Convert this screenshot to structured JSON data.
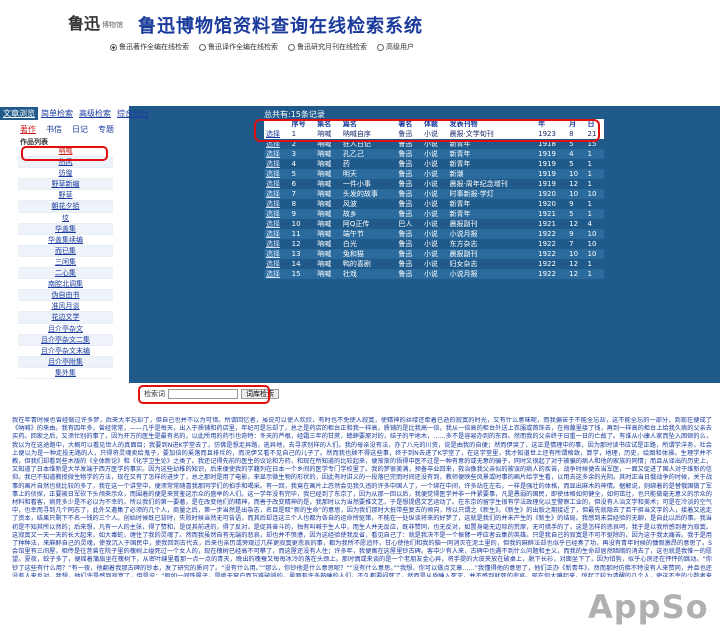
{
  "header": {
    "logo_main": "鲁迅",
    "logo_sub": "博物馆",
    "title": "鲁迅博物馆资料查询在线检索系统",
    "radios": [
      {
        "label": "鲁迅著作全编在线检索",
        "checked": true
      },
      {
        "label": "鲁迅译作全编在线检索",
        "checked": false
      },
      {
        "label": "鲁迅研究月刊在线检索",
        "checked": false
      },
      {
        "label": "高级用户",
        "checked": false
      }
    ]
  },
  "nav": {
    "tabs": [
      "文章浏览",
      "简单检索",
      "高级检索",
      "综合统计"
    ],
    "subtabs": [
      "著作",
      "书信",
      "日记",
      "专题"
    ],
    "work_header": "作品列表",
    "works": [
      "呐喊",
      "热风",
      "彷徨",
      "野草新编",
      "野草",
      "朝花夕拾",
      "坟",
      "华盖集",
      "华盖集续编",
      "而已集",
      "三闲集",
      "二心集",
      "南腔北调集",
      "伪自由书",
      "准风月谈",
      "花边文学",
      "且介亭杂文",
      "且介亭杂文二集",
      "且介亭杂文末编",
      "且介亭附集",
      "集外集"
    ]
  },
  "results": {
    "total": "总共有:15条记录",
    "columns": [
      "",
      "序号",
      "集名",
      "篇名",
      "署名",
      "体裁",
      "发表刊物",
      "年",
      "月",
      "日"
    ],
    "rows": [
      [
        "选择",
        "1",
        "呐喊",
        "呐喊自序",
        "鲁迅",
        "小说",
        "晨报·文学旬刊",
        "1923",
        "8",
        "21"
      ],
      [
        "选择",
        "2",
        "呐喊",
        "狂人日记",
        "鲁迅",
        "小说",
        "新青年",
        "1918",
        "5",
        "15"
      ],
      [
        "选择",
        "3",
        "呐喊",
        "孔乙己",
        "鲁迅",
        "小说",
        "新青年",
        "1919",
        "4",
        "1"
      ],
      [
        "选择",
        "4",
        "呐喊",
        "药",
        "鲁迅",
        "小说",
        "新青年",
        "1919",
        "5",
        "1"
      ],
      [
        "选择",
        "5",
        "呐喊",
        "明天",
        "鲁迅",
        "小说",
        "新潮",
        "1919",
        "10",
        "1"
      ],
      [
        "选择",
        "6",
        "呐喊",
        "一件小事",
        "鲁迅",
        "小说",
        "晨报·周年纪念增刊",
        "1919",
        "12",
        "1"
      ],
      [
        "选择",
        "7",
        "呐喊",
        "头发的故事",
        "鲁迅",
        "小说",
        "时事新报·学灯",
        "1920",
        "10",
        "10"
      ],
      [
        "选择",
        "8",
        "呐喊",
        "风波",
        "鲁迅",
        "小说",
        "新青年",
        "1920",
        "9",
        "1"
      ],
      [
        "选择",
        "9",
        "呐喊",
        "故乡",
        "鲁迅",
        "小说",
        "新青年",
        "1921",
        "5",
        "1"
      ],
      [
        "选择",
        "10",
        "呐喊",
        "阿Q正传",
        "巴人",
        "小说",
        "晨报副刊",
        "1921",
        "12",
        "4"
      ],
      [
        "选择",
        "11",
        "呐喊",
        "端午节",
        "鲁迅",
        "小说",
        "小说月报",
        "1922",
        "9",
        "10"
      ],
      [
        "选择",
        "12",
        "呐喊",
        "白光",
        "鲁迅",
        "小说",
        "东方杂志",
        "1922",
        "7",
        "10"
      ],
      [
        "选择",
        "13",
        "呐喊",
        "兔和猫",
        "鲁迅",
        "小说",
        "晨报副刊",
        "1922",
        "10",
        "10"
      ],
      [
        "选择",
        "14",
        "呐喊",
        "鸭的喜剧",
        "鲁迅",
        "小说",
        "妇女杂志",
        "1922",
        "12",
        "1"
      ],
      [
        "选择",
        "15",
        "呐喊",
        "社戏",
        "鲁迅",
        "小说",
        "小说月报",
        "1922",
        "12",
        "1"
      ]
    ]
  },
  "search": {
    "label": "检索词",
    "value": "",
    "button": "词库检索"
  },
  "body_text": "我在年青时候也曾经做过许多梦，后来大半忘却了，但自己也并不以为可惜。所谓回忆者，虽说可以使人欢欣，有时也不免使人寂寞，使精神的丝缕还牵着已逝的寂寞的时光，又有什么意味呢，而我偏苦于不能全忘却，这不能全忘的一部分，到现在便成了《呐喊》的来由。我有四年多，曾经常常，——几乎是每天，出入于质铺和药店里，年纪可是忘却了，总之是药店的柜台正和我一样高，质铺的是比我高一倍，我从一倍高的柜台外送上衣服或首饰去，在侮蔑里接了钱，再到一样高的柜台上给我久病的父亲去买药。回家之后，又须忙别的事了，因为开方的医生是最有名的，以此所用的药引也奇特：冬天的芦根，经霜三年的甘蔗，蟋蟀要原对的，结子的平地木，……多不是容易办到的东西。然而我的父亲终于日重一日的亡故了。有谁从小康人家而坠入困顿的么，我以为在这途路中，大概可以看见世人的真面目；我要到N进K学堂去了，仿佛是想走异路，逃异地，去寻求别样的人们。我的母亲没有法，办了八元的川资，说是由我的自便；然而伊哭了，这正是情理中的事，因为那时读书应试是正路，所谓学洋务，社会上便以为是一种走投无路的人，只得将灵魂卖给鬼子，要加倍的奚落而且排斥的，而况伊又看不见自己的儿子了。然而我也顾不得这些事，终于到N去进了K学堂了，在这学堂里，我才知道世上还有所谓格致，算学，地理，历史，绘图和体操。生理学并不教，但我们却看到些木版的《全体新论》和《化学卫生论》之类了。我还记得先前的医生的议论和方药，和现在所知道的比较起来，便渐渐的悟得中医不过是一种有意的或无意的骗子，同时又很起了对于被骗的病人和他的家族的同情；而且从译出的历史上，又知道了日本维新是大半发端于西方医学的事实。因为这些幼稚的知识，后来便使我的学籍列在日本一个乡间的医学专门学校里了。我的梦很美满，预备卒业回来，救治像我父亲似的被误的病人的疾苦，战争时候便去当军医，一面又促进了国人对于维新的信仰。我已不知道教授微生物学的方法，现在又有了怎样的进步了，总之那时是用了电影，来显示微生物的形状的，因此有时讲义的一段落已完而时间还没有到，教师便映些风景或时事的画片给学生看，以用去这多余的光阴。其时正当日俄战争的时候，关于战事的画片自然也就比较的多了，我在这一个讲堂中，便须常常随喜我那同学们的拍手和喝采。有一回，我竟在画片上忽然会见我久违的许多中国人了，一个绑在中间，许多站在左右，一样是强壮的体格，而显出麻木的神情。据解说，则绑着的是替俄国做了军事上的侦探，正要被日军砍下头颅来示众，而围着的便是来赏鉴这示众的盛举的人们。这一学年没有完毕，我已经到了东京了，因为从那一回以后，我便觉得医学并非一件紧要事，凡是愚弱的国民，即使体格如何健全，如何茁壮，也只能做毫无意义的示众的材料和看客，病死多少是不必以为不幸的。所以我们的第一要著，是在改变他们的精神，而善于改变精神的是，我那时以为当然要推文艺，于是想提倡文艺运动了。在东京的留学生很有学法政理化以至警察工业的，但没有人治文学和美术；可是在冷淡的空气中，也幸而寻到几个同志了，此外又邀集了必须的几个人，商量之后，第一步当然是出杂志，名目是取“新的生命”的意思，因为我们那时大抵带些复古的倾向，所以只谓之《新生》。《新生》的出版之期接近了，但最先就隐去了若干担当文字的人，接着又逃走了资本，结果只剩下不名一钱的三个人。创始时候既已背时，失败时候当然无可告语，而其后却连这三个人也都为各自的运命所驱策，不能在一处纵谈将来的好梦了，这就是我们的并未产生的《新生》的结局。我感到未尝经验的无聊，是自此以后的事。我当初是不知其所以然的；后来想，凡有一人的主张，得了赞和，是促其前进的，得了反对，是促其奋斗的，独有叫喊于生人中，而生人并无反应，既非赞同，也无反对，如置身毫无边际的荒原，无可措手的了，这是怎样的悲哀呵，我于是以我所感到者为寂寞。这寂寞又一天一天的长大起来，如大毒蛇，缠住了我的灵魂了。然而我虽然自有无端的悲哀，却也并不愤懑，因为这经验使我反省，看见自己了：就是我决不是一个振臂一呼应者云集的英雄。只是我自己的寂寞是不可不驱除的，因为这于我太痛苦。我于是用了种种法，来麻醉自己的灵魂，使我沉入于国民中，使我回到古代去，后来也亲历或旁观过几样更寂寞更悲哀的事，都为我所不愿追怀，甘心使他们和我的脑一同消灭在泥土里的，但我的麻醉法却也似乎已经奏了功，再没有青年时候的慷慨激昂的意思了。S会馆里有三间屋，相传是往昔曾在院子里的槐树上缢死过一个女人的，现在槐树已经高不可攀了，而这屋还没有人住；许多年，我便寓在这屋里钞古碑。客中少有人来，古碑中也遇不到什么问题和主义，而我的生命却居然暗暗的消去了，这也就是我惟一的愿望。夏夜，蚊子多了，便摇着蒲扇坐在槐树下，从密叶缝里看那一点一点的青天，晚出的槐蚕又每每冰冷的落在头颈上。那时偶或来谈的是一个老朋友金心异，将手提的大皮夹放在破桌上，脱下长衫，对面坐下了，因为怕狗，似乎心房还在怦怦的跳动。“你钞了这些有什么用？”有一夜，他翻着我那古碑的钞本，发了研究的质问了。“没有什么用。”“那么，你钞他是什么意思呢？”“没有什么意思。”“我想，你可以做点文章……”我懂得他的意思了，他们正办《新青年》，然而那时仿佛不特没有人来赞同，并且也还没有人来反对，我想，他们许是感到寂寞了，但是说：“假如一间铁屋子，是绝无窗户而万难破毁的，里面有许多熟睡的人们，不久都要闷死了，然而是从昏睡入死灭，并不感到就死的悲哀。现在你大嚷起来，惊起了较为清醒的几个人，使这不幸的少数者来受无可挽救的临终的苦楚，你倒以为对得起他们么？”“然而几个人既然起来，你不能说决没有毁坏这铁屋的希望。”是的，我虽然自有我的确信，然而说到希望，却是不能抹杀的，因为希望是在于将来，决不能以我之必无的证明，来折服了他之所谓可有，于是我终于答应他也做文章了，这便是最初的一篇《狂人日记》。从此以后，便一发而不可收，每写些小说模样的文章，以敷衍朋友们的嘱托，积久就有了十余篇。在我自己，本以为现在是已经并非一个切迫而不能已于言的人了，但或者也还未能忘怀于当日自己的寂寞的悲哀罢，所以有时候仍不免呐喊几声，聊以慰藉那在寂寞里奔驰的猛士，使他不惮于前驱。至于我的喊声是勇猛或是悲哀，是可憎或是可笑，那倒是不暇顾及的；但既然是呐喊，则当然须听将令的了，所以我往往不恤用了曲笔，在《药》的瑜儿的坟上平空添上一个花环，在《明天》里也不叙单四嫂子竟没有做到看见儿子的梦，因为那时的主将是不主张消极的。至于自己，却也并不愿将自以为苦的寂寞，再来传染给也如我那年青时候似的正做着好梦的青年。这样说来，我的小说和艺术的距离之远，也就可想而知了，然而到今日还能蒙着小说的名，甚而至于且有成集的机会，无论如何总不能不说是一件侥幸的事，但侥幸虽使我不安于心，而悬揣人间暂时还有读者，则究竟也仍然是高兴的。所以我竟将我的短篇小说结集起来，而且付印了，又因为上面所说的缘由，便称之为《呐喊》。一九二二年十二月三日，鲁迅记于北京。",
  "watermark": "AppSo"
}
